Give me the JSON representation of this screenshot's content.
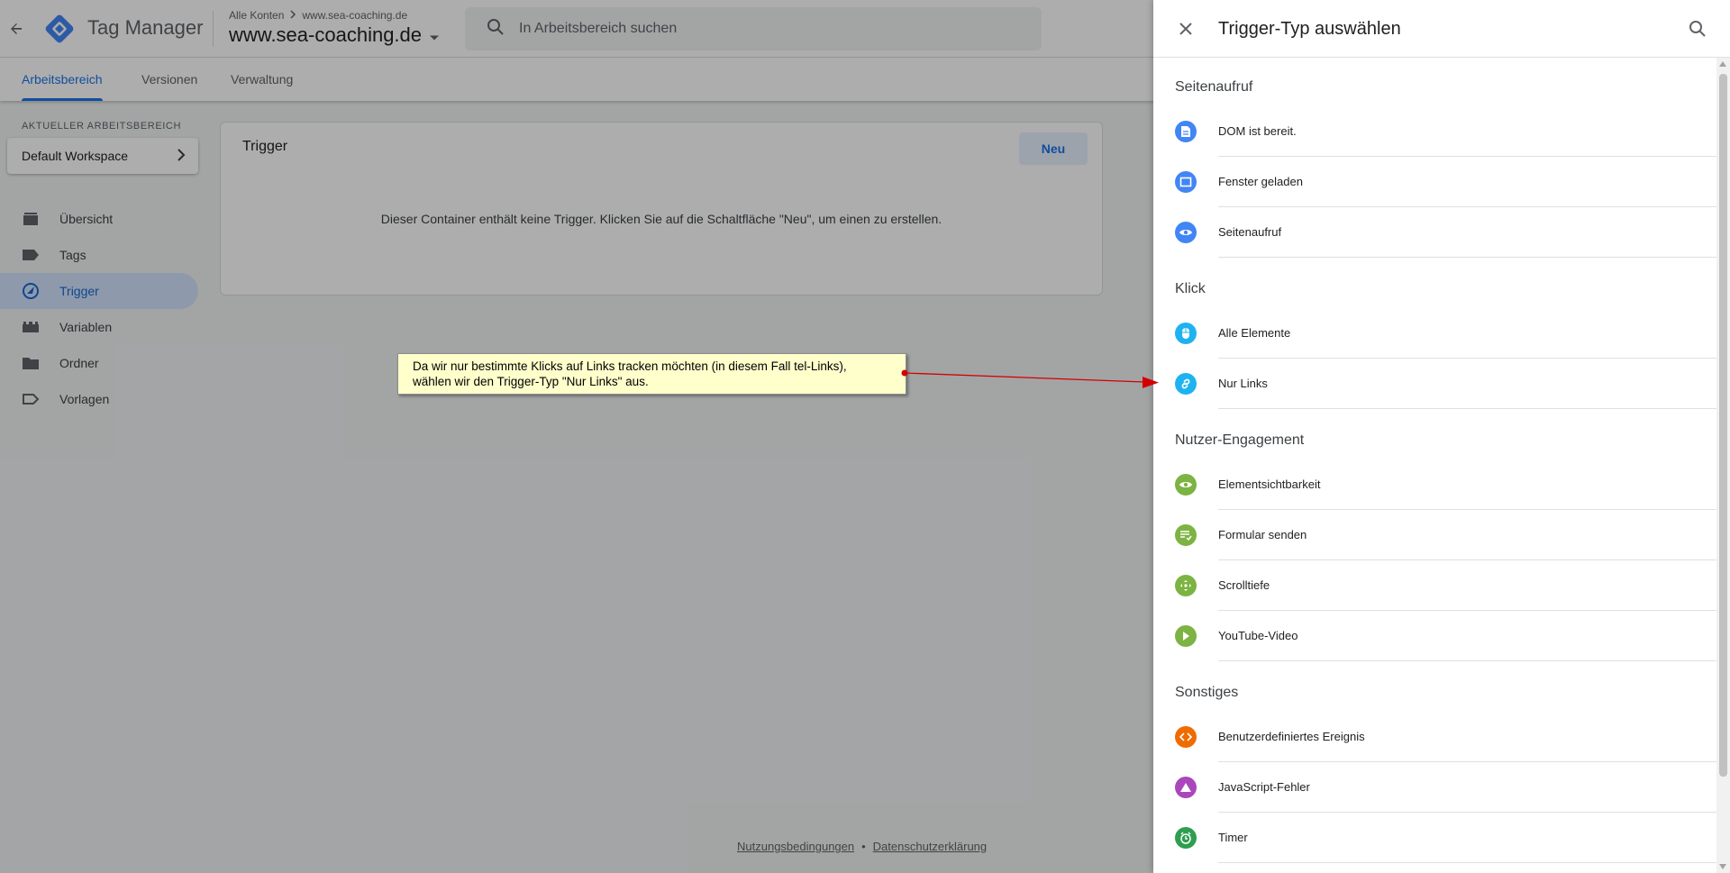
{
  "header": {
    "product_name": "Tag Manager",
    "breadcrumb_account": "Alle Konten",
    "breadcrumb_container": "www.sea-coaching.de",
    "container_name": "www.sea-coaching.de",
    "search_placeholder": "In Arbeitsbereich suchen"
  },
  "tabs": [
    {
      "label": "Arbeitsbereich",
      "active": true
    },
    {
      "label": "Versionen",
      "active": false
    },
    {
      "label": "Verwaltung",
      "active": false
    }
  ],
  "sidebar": {
    "workspace_label": "AKTUELLER ARBEITSBEREICH",
    "workspace_name": "Default Workspace",
    "items": [
      {
        "label": "Übersicht",
        "icon": "overview-icon"
      },
      {
        "label": "Tags",
        "icon": "tag-icon"
      },
      {
        "label": "Trigger",
        "icon": "trigger-icon",
        "active": true
      },
      {
        "label": "Variablen",
        "icon": "variables-icon"
      },
      {
        "label": "Ordner",
        "icon": "folder-icon"
      },
      {
        "label": "Vorlagen",
        "icon": "template-icon"
      }
    ]
  },
  "main": {
    "card_title": "Trigger",
    "new_button": "Neu",
    "empty_message": "Dieser Container enthält keine Trigger. Klicken Sie auf die Schaltfläche \"Neu\", um einen zu erstellen."
  },
  "footer": {
    "terms": "Nutzungsbedingungen",
    "separator": "•",
    "privacy": "Datenschutzerklärung"
  },
  "callout": {
    "line1": "Da wir nur bestimmte Klicks auf Links tracken möchten (in diesem Fall tel-Links),",
    "line2": "wählen wir den Trigger-Typ \"Nur Links\" aus."
  },
  "panel": {
    "title": "Trigger-Typ auswählen",
    "sections": [
      {
        "title": "Seitenaufruf",
        "items": [
          {
            "label": "DOM ist bereit.",
            "icon": "document-icon",
            "color": "#4285f4"
          },
          {
            "label": "Fenster geladen",
            "icon": "window-icon",
            "color": "#4285f4"
          },
          {
            "label": "Seitenaufruf",
            "icon": "eye-icon",
            "color": "#4285f4"
          }
        ]
      },
      {
        "title": "Klick",
        "items": [
          {
            "label": "Alle Elemente",
            "icon": "mouse-icon",
            "color": "#1eb3f0"
          },
          {
            "label": "Nur Links",
            "icon": "link-icon",
            "color": "#1eb3f0"
          }
        ]
      },
      {
        "title": "Nutzer-Engagement",
        "items": [
          {
            "label": "Elementsichtbarkeit",
            "icon": "eye-icon",
            "color": "#7cb342"
          },
          {
            "label": "Formular senden",
            "icon": "form-icon",
            "color": "#7cb342"
          },
          {
            "label": "Scrolltiefe",
            "icon": "scroll-icon",
            "color": "#7cb342"
          },
          {
            "label": "YouTube-Video",
            "icon": "play-icon",
            "color": "#7cb342"
          }
        ]
      },
      {
        "title": "Sonstiges",
        "items": [
          {
            "label": "Benutzerdefiniertes Ereignis",
            "icon": "code-icon",
            "color": "#ef6c00"
          },
          {
            "label": "JavaScript-Fehler",
            "icon": "warning-icon",
            "color": "#ab47bc"
          },
          {
            "label": "Timer",
            "icon": "timer-icon",
            "color": "#2e9e4f"
          }
        ]
      }
    ]
  },
  "colors": {
    "accent": "#1a73e8",
    "callout_bg": "#ffffcc",
    "arrow": "#d40000"
  }
}
